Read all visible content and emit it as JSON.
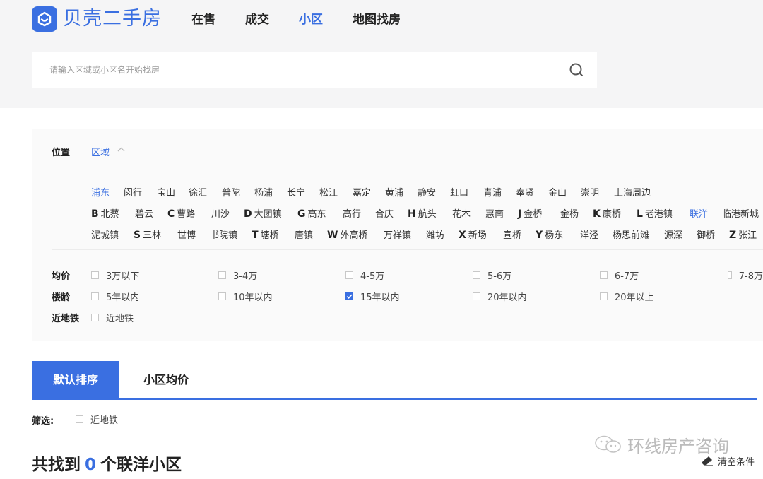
{
  "brand": {
    "name": "贝壳二手房",
    "accent": "#3a6fe1"
  },
  "nav": [
    {
      "label": "在售",
      "active": false
    },
    {
      "label": "成交",
      "active": false
    },
    {
      "label": "小区",
      "active": true
    },
    {
      "label": "地图找房",
      "active": false
    }
  ],
  "search": {
    "placeholder": "请输入区域或小区名开始找房",
    "value": "",
    "icon": "search-icon"
  },
  "filter": {
    "position_label": "位置",
    "area_tab": "区域",
    "districts": [
      "浦东",
      "闵行",
      "宝山",
      "徐汇",
      "普陀",
      "杨浦",
      "长宁",
      "松江",
      "嘉定",
      "黄浦",
      "静安",
      "虹口",
      "青浦",
      "奉贤",
      "金山",
      "崇明",
      "上海周边"
    ],
    "selected_district": "浦东",
    "towns_row1": [
      {
        "letter": "B",
        "name": "北蔡"
      },
      {
        "letter": "",
        "name": "碧云"
      },
      {
        "letter": "C",
        "name": "曹路"
      },
      {
        "letter": "",
        "name": "川沙"
      },
      {
        "letter": "D",
        "name": "大团镇"
      },
      {
        "letter": "G",
        "name": "高东"
      },
      {
        "letter": "",
        "name": "高行"
      },
      {
        "letter": "",
        "name": "合庆"
      },
      {
        "letter": "H",
        "name": "航头"
      },
      {
        "letter": "",
        "name": "花木"
      },
      {
        "letter": "",
        "name": "惠南"
      },
      {
        "letter": "J",
        "name": "金桥"
      },
      {
        "letter": "",
        "name": "金杨"
      },
      {
        "letter": "K",
        "name": "康桥"
      },
      {
        "letter": "L",
        "name": "老港镇"
      },
      {
        "letter": "",
        "name": "联洋"
      },
      {
        "letter": "",
        "name": "临港新城"
      }
    ],
    "towns_row2": [
      {
        "letter": "",
        "name": "泥城镇"
      },
      {
        "letter": "S",
        "name": "三林"
      },
      {
        "letter": "",
        "name": "世博"
      },
      {
        "letter": "",
        "name": "书院镇"
      },
      {
        "letter": "T",
        "name": "塘桥"
      },
      {
        "letter": "",
        "name": "唐镇"
      },
      {
        "letter": "W",
        "name": "外高桥"
      },
      {
        "letter": "",
        "name": "万祥镇"
      },
      {
        "letter": "",
        "name": "潍坊"
      },
      {
        "letter": "X",
        "name": "新场"
      },
      {
        "letter": "",
        "name": "宣桥"
      },
      {
        "letter": "Y",
        "name": "杨东"
      },
      {
        "letter": "",
        "name": "洋泾"
      },
      {
        "letter": "",
        "name": "杨思前滩"
      },
      {
        "letter": "",
        "name": "源深"
      },
      {
        "letter": "",
        "name": "御桥"
      },
      {
        "letter": "Z",
        "name": "张江"
      }
    ],
    "selected_town": "联洋",
    "price_label": "均价",
    "price_options": [
      {
        "label": "3万以下",
        "checked": false
      },
      {
        "label": "3-4万",
        "checked": false
      },
      {
        "label": "4-5万",
        "checked": false
      },
      {
        "label": "5-6万",
        "checked": false
      },
      {
        "label": "6-7万",
        "checked": false
      },
      {
        "label": "7-8万",
        "checked": false
      }
    ],
    "age_label": "楼龄",
    "age_options": [
      {
        "label": "5年以内",
        "checked": false
      },
      {
        "label": "10年以内",
        "checked": false
      },
      {
        "label": "15年以内",
        "checked": true
      },
      {
        "label": "20年以内",
        "checked": false
      },
      {
        "label": "20年以上",
        "checked": false
      }
    ],
    "subway_label": "近地铁",
    "subway_option": {
      "label": "近地铁",
      "checked": false
    }
  },
  "sort": {
    "tabs": [
      "默认排序",
      "小区均价"
    ],
    "active_index": 0
  },
  "screen": {
    "label": "筛选:",
    "option": "近地铁"
  },
  "result": {
    "prefix": "共找到",
    "count": "0",
    "suffix": "个联洋小区"
  },
  "watermark": "环线房产咨询",
  "clear_conditions": "清空条件"
}
